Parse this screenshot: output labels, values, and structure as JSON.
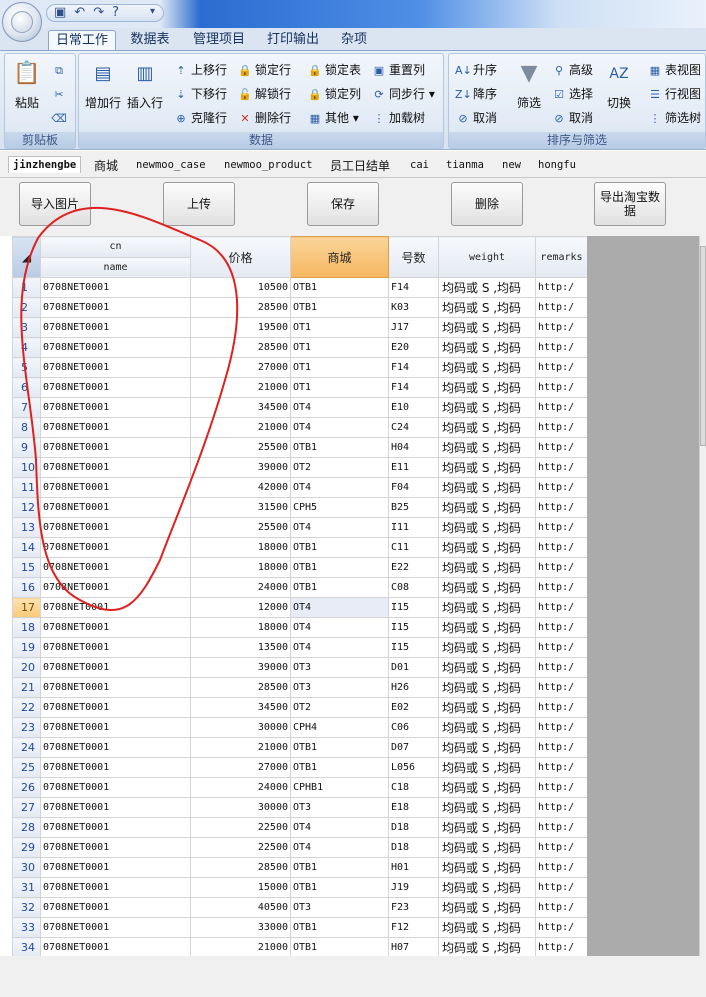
{
  "qat": {
    "icons": [
      "save-icon",
      "undo-icon",
      "redo-icon",
      "help-icon"
    ],
    "save_glyph": "▣",
    "undo_glyph": "↶",
    "redo_glyph": "↷",
    "help_glyph": "?",
    "more_glyph": "▾"
  },
  "ribbon_tabs": [
    "日常工作",
    "数据表",
    "管理项目",
    "打印输出",
    "杂项"
  ],
  "ribbon": {
    "clipboard": {
      "label": "剪贴板",
      "paste": "粘贴"
    },
    "data": {
      "label": "数据",
      "add_row": "增加行",
      "insert_row": "插入行",
      "move_up": "上移行",
      "move_down": "下移行",
      "clone_row": "克隆行",
      "lock_row": "锁定行",
      "unlock_row": "解锁行",
      "delete_row": "删除行",
      "lock_table": "锁定表",
      "lock_col": "锁定列",
      "other": "其他",
      "reset_col": "重置列",
      "sync_row": "同步行",
      "load_tree": "加载树"
    },
    "sort": {
      "label": "排序与筛选",
      "asc": "升序",
      "desc": "降序",
      "cancel": "取消",
      "filter": "筛选",
      "advanced": "高级",
      "select": "选择",
      "cancel2": "取消",
      "toggle": "切换",
      "table_view": "表视图",
      "row_view": "行视图",
      "filter_tree": "筛选树"
    }
  },
  "sheet_tabs": [
    "jinzhengbe",
    "商城",
    "newmoo_case",
    "newmoo_product",
    "员工日结单",
    "cai",
    "tianma",
    "new",
    "hongfu"
  ],
  "toolbar": {
    "import_image": "导入图片",
    "upload": "上传",
    "save": "保存",
    "delete": "删除",
    "export_taobao": "导出淘宝数据"
  },
  "grid": {
    "columns": {
      "cn": "cn",
      "name": "name",
      "price": "价格",
      "mall": "商城",
      "number": "号数",
      "weight": "weight",
      "remarks": "remarks"
    },
    "rows": [
      [
        "1",
        "0708NET0001",
        "10500",
        "OTB1",
        "F14",
        "均码或 S ,均码",
        "http:/"
      ],
      [
        "2",
        "0708NET0001",
        "28500",
        "OTB1",
        "K03",
        "均码或 S ,均码",
        "http:/"
      ],
      [
        "3",
        "0708NET0001",
        "19500",
        "OT1",
        "J17",
        "均码或 S ,均码",
        "http:/"
      ],
      [
        "4",
        "0708NET0001",
        "28500",
        "OT1",
        "E20",
        "均码或 S ,均码",
        "http:/"
      ],
      [
        "5",
        "0708NET0001",
        "27000",
        "OT1",
        "F14",
        "均码或 S ,均码",
        "http:/"
      ],
      [
        "6",
        "0708NET0001",
        "21000",
        "OT1",
        "F14",
        "均码或 S ,均码",
        "http:/"
      ],
      [
        "7",
        "0708NET0001",
        "34500",
        "OT4",
        "E10",
        "均码或 S ,均码",
        "http:/"
      ],
      [
        "8",
        "0708NET0001",
        "21000",
        "OT4",
        "C24",
        "均码或 S ,均码",
        "http:/"
      ],
      [
        "9",
        "0708NET0001",
        "25500",
        "OTB1",
        "H04",
        "均码或 S ,均码",
        "http:/"
      ],
      [
        "10",
        "0708NET0001",
        "39000",
        "OT2",
        "E11",
        "均码或 S ,均码",
        "http:/"
      ],
      [
        "11",
        "0708NET0001",
        "42000",
        "OT4",
        "F04",
        "均码或 S ,均码",
        "http:/"
      ],
      [
        "12",
        "0708NET0001",
        "31500",
        "CPH5",
        "B25",
        "均码或 S ,均码",
        "http:/"
      ],
      [
        "13",
        "0708NET0001",
        "25500",
        "OT4",
        "I11",
        "均码或 S ,均码",
        "http:/"
      ],
      [
        "14",
        "0708NET0001",
        "18000",
        "OTB1",
        "C11",
        "均码或 S ,均码",
        "http:/"
      ],
      [
        "15",
        "0708NET0001",
        "18000",
        "OTB1",
        "E22",
        "均码或 S ,均码",
        "http:/"
      ],
      [
        "16",
        "0708NET0001",
        "24000",
        "OTB1",
        "C08",
        "均码或 S ,均码",
        "http:/"
      ],
      [
        "17",
        "0708NET0001",
        "12000",
        "OT4",
        "I15",
        "均码或 S ,均码",
        "http:/"
      ],
      [
        "18",
        "0708NET0001",
        "18000",
        "OT4",
        "I15",
        "均码或 S ,均码",
        "http:/"
      ],
      [
        "19",
        "0708NET0001",
        "13500",
        "OT4",
        "I15",
        "均码或 S ,均码",
        "http:/"
      ],
      [
        "20",
        "0708NET0001",
        "39000",
        "OT3",
        "D01",
        "均码或 S ,均码",
        "http:/"
      ],
      [
        "21",
        "0708NET0001",
        "28500",
        "OT3",
        "H26",
        "均码或 S ,均码",
        "http:/"
      ],
      [
        "22",
        "0708NET0001",
        "34500",
        "OT2",
        "E02",
        "均码或 S ,均码",
        "http:/"
      ],
      [
        "23",
        "0708NET0001",
        "30000",
        "CPH4",
        "C06",
        "均码或 S ,均码",
        "http:/"
      ],
      [
        "24",
        "0708NET0001",
        "21000",
        "OTB1",
        "D07",
        "均码或 S ,均码",
        "http:/"
      ],
      [
        "25",
        "0708NET0001",
        "27000",
        "OTB1",
        "L056",
        "均码或 S ,均码",
        "http:/"
      ],
      [
        "26",
        "0708NET0001",
        "24000",
        "CPHB1",
        "C18",
        "均码或 S ,均码",
        "http:/"
      ],
      [
        "27",
        "0708NET0001",
        "30000",
        "OT3",
        "E18",
        "均码或 S ,均码",
        "http:/"
      ],
      [
        "28",
        "0708NET0001",
        "22500",
        "OT4",
        "D18",
        "均码或 S ,均码",
        "http:/"
      ],
      [
        "29",
        "0708NET0001",
        "22500",
        "OT4",
        "D18",
        "均码或 S ,均码",
        "http:/"
      ],
      [
        "30",
        "0708NET0001",
        "28500",
        "OTB1",
        "H01",
        "均码或 S ,均码",
        "http:/"
      ],
      [
        "31",
        "0708NET0001",
        "15000",
        "OTB1",
        "J19",
        "均码或 S ,均码",
        "http:/"
      ],
      [
        "32",
        "0708NET0001",
        "40500",
        "OT3",
        "F23",
        "均码或 S ,均码",
        "http:/"
      ],
      [
        "33",
        "0708NET0001",
        "33000",
        "OTB1",
        "F12",
        "均码或 S ,均码",
        "http:/"
      ],
      [
        "34",
        "0708NET0001",
        "21000",
        "OTB1",
        "H07",
        "均码或 S ,均码",
        "http:/"
      ]
    ],
    "current_row": 17
  },
  "colors": {
    "annotation": "#e0201e",
    "header_highlight": "#f5b75e",
    "ribbon_blue": "#2a6cd0"
  }
}
